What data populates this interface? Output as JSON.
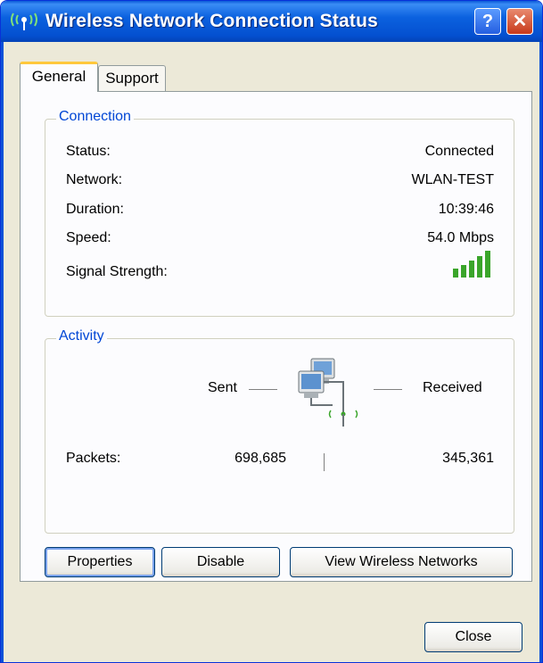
{
  "window": {
    "title": "Wireless Network Connection Status"
  },
  "titlebar_buttons": {
    "help": "?",
    "close": "✕"
  },
  "tabs": [
    {
      "label": "General",
      "active": true
    },
    {
      "label": "Support",
      "active": false
    }
  ],
  "connection": {
    "legend": "Connection",
    "rows": [
      {
        "label": "Status:",
        "value": "Connected"
      },
      {
        "label": "Network:",
        "value": "WLAN-TEST"
      },
      {
        "label": "Duration:",
        "value": "10:39:46"
      },
      {
        "label": "Speed:",
        "value": "54.0 Mbps"
      }
    ],
    "signal_label": "Signal Strength:",
    "signal_bars": 5
  },
  "activity": {
    "legend": "Activity",
    "sent_label": "Sent",
    "received_label": "Received",
    "packets_label": "Packets:",
    "packets_sent": "698,685",
    "packets_received": "345,361"
  },
  "buttons": {
    "properties": "Properties",
    "disable": "Disable",
    "view_networks": "View Wireless Networks",
    "close": "Close"
  },
  "colors": {
    "title_blue": "#0a5ad8",
    "legend_blue": "#0046d5",
    "signal_green": "#3aa52a"
  }
}
